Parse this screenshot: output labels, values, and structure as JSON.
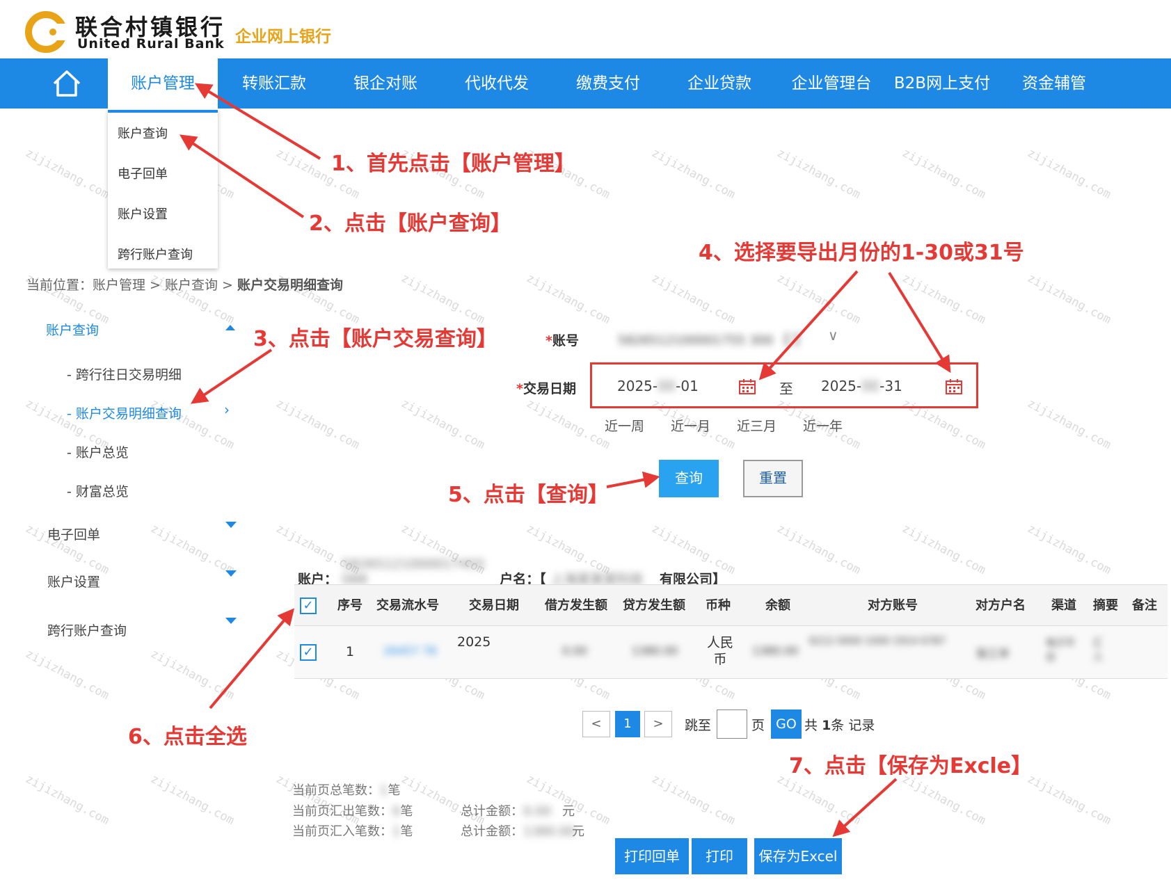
{
  "brand": {
    "name_cn": "联合村镇银行",
    "name_en": "United Rural Bank",
    "subtitle": "企业网上银行"
  },
  "nav": {
    "items": [
      "账户管理",
      "转账汇款",
      "银企对账",
      "代收代发",
      "缴费支付",
      "企业贷款",
      "企业管理台",
      "B2B网上支付",
      "资金辅管"
    ]
  },
  "dropdown": {
    "items": [
      "账户查询",
      "电子回单",
      "账户设置",
      "跨行账户查询"
    ]
  },
  "breadcrumb": {
    "prefix": "当前位置：",
    "path": "账户管理 > 账户查询 > ",
    "current": "账户交易明细查询"
  },
  "sidebar": {
    "group1": "账户查询",
    "sub_items": [
      "- 跨行往日交易明细",
      "- 账户交易明细查询",
      "- 账户总览",
      "- 财富总览"
    ],
    "group2": "电子回单",
    "group3": "账户设置",
    "group4": "跨行账户查询"
  },
  "form": {
    "account_label": "账号",
    "account_value": "5826512100001755 300 【 】",
    "date_label": "交易日期",
    "date_start": "2025-",
    "date_start_day": "-01",
    "date_sep": "至",
    "date_end": "2025-",
    "date_end_day": "-31",
    "quick": [
      "近一周",
      "近一月",
      "近三月",
      "近一年"
    ],
    "query_button": "查询",
    "reset_button": "重置"
  },
  "result": {
    "account_label": "账户：",
    "account_value": "58265121000017455 088",
    "name_label": "户名：【",
    "name_value": "上海某某某科技",
    "name_suffix": "有限公司】",
    "columns": [
      "序号",
      "交易流水号",
      "交易日期",
      "借方发生额",
      "贷方发生额",
      "币种",
      "余额",
      "对方账号",
      "对方户名",
      "渠道",
      "摘要",
      "备注"
    ],
    "row": {
      "index": "1",
      "serial": "26457 78",
      "date": "2025",
      "debit": "0.00",
      "credit": "1380.00",
      "currency": "人民币",
      "balance": "1380.00",
      "counter_account": "6212 0000 1000 1914 6787",
      "counter_name": "张三丰",
      "channel": "电子平台",
      "summary": "汇入",
      "remark": ""
    }
  },
  "pagination": {
    "prev": "<",
    "page": "1",
    "next": ">",
    "jump_label": "跳至",
    "page_label": "页",
    "go": "GO",
    "total_prefix": "共",
    "total_count": "1",
    "total_suffix": "条 记录"
  },
  "summary": {
    "page_total": "当前页总笔数：",
    "page_total_val": "1",
    "unit": "笔",
    "out_count": "当前页汇出笔数：",
    "out_count_val": "0",
    "in_count": "当前页汇入笔数：",
    "in_count_val": "1",
    "amount_label": "总计金额：",
    "out_amount": "0.00",
    "in_amount": "1380.00",
    "yuan": "元"
  },
  "bottom_buttons": {
    "print_receipt": "打印回单",
    "print": "打印",
    "save_excel": "保存为Excel"
  },
  "annotations": {
    "step1": "1、首先点击【账户管理】",
    "step2": "2、点击【账户查询】",
    "step3": "3、点击【账户交易查询】",
    "step4": "4、选择要导出月份的1-30或31号",
    "step5": "5、点击【查询】",
    "step6": "6、点击全选",
    "step7": "7、点击【保存为Excle】"
  },
  "watermark": "zijizhang.com",
  "colors": {
    "nav_blue": "#1e88e5",
    "annotation_red": "#e53935",
    "brand_gold": "#e8a317"
  }
}
